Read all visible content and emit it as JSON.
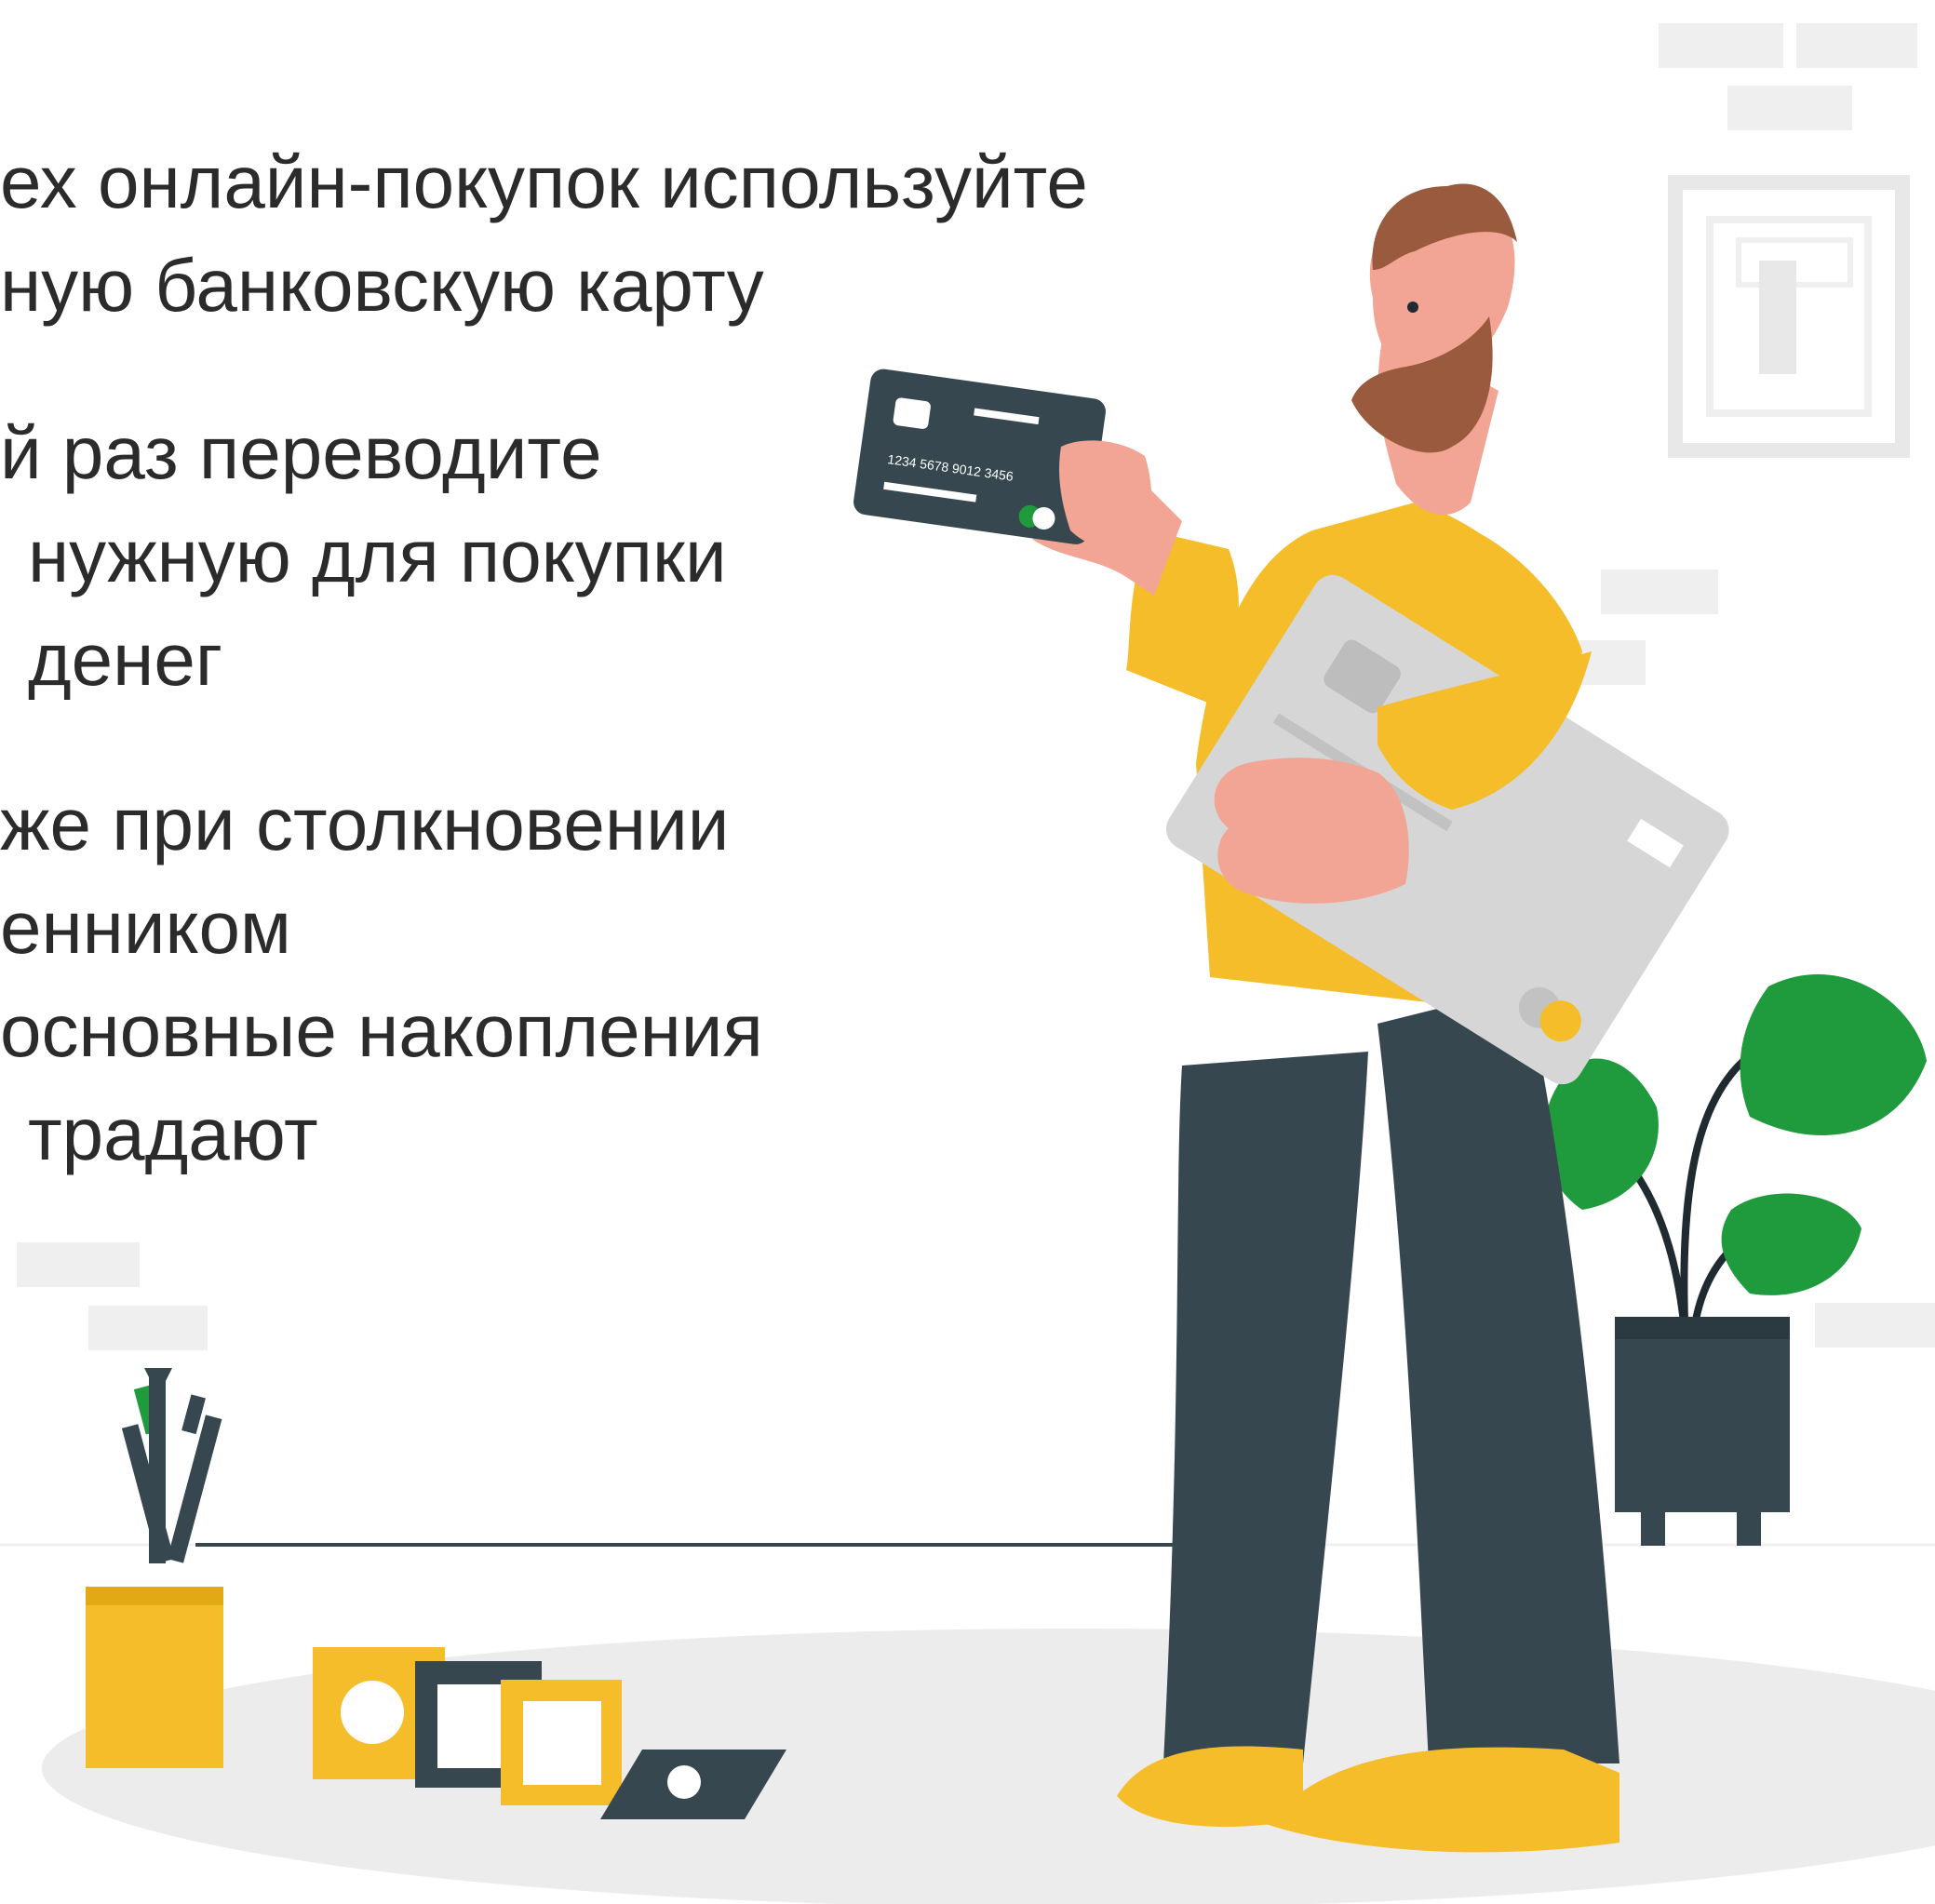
{
  "tips": [
    {
      "lines": [
        "ех онлайн-покупок используйте",
        "ную банковскую карту"
      ]
    },
    {
      "lines": [
        "й раз переводите",
        "нужную для покупки",
        "денег"
      ]
    },
    {
      "lines": [
        "же при столкновении",
        "енником",
        "основные накопления",
        "традают"
      ]
    }
  ],
  "illustration": {
    "subject": "man holding bank cards",
    "card_number": "1234 5678 9012 3456",
    "colors": {
      "yellow": "#f5bd2a",
      "dark": "#37474f",
      "skin": "#f2a594",
      "beard": "#9a5a3e",
      "card_gray": "#d6d6d6",
      "plant_green": "#1f9a3c",
      "floor": "#ececec"
    }
  }
}
